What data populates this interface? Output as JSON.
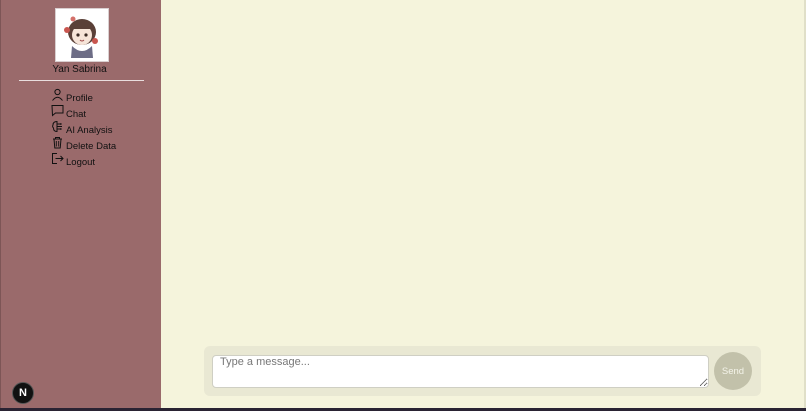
{
  "user": {
    "name": "Yan Sabrina"
  },
  "nav": [
    {
      "label": "Profile",
      "icon": "user-icon"
    },
    {
      "label": "Chat",
      "icon": "chat-bubble-icon"
    },
    {
      "label": "AI Analysis",
      "icon": "ai-brain-icon"
    },
    {
      "label": "Delete Data",
      "icon": "trash-icon"
    },
    {
      "label": "Logout",
      "icon": "logout-icon"
    }
  ],
  "composer": {
    "placeholder": "Type a message...",
    "send_label": "Send"
  },
  "dev_badge": {
    "label": "N"
  },
  "colors": {
    "sidebar": "#9a6a6b",
    "main": "#f5f4dc",
    "composer": "#e9e8d3",
    "send": "#c2c1aa"
  }
}
